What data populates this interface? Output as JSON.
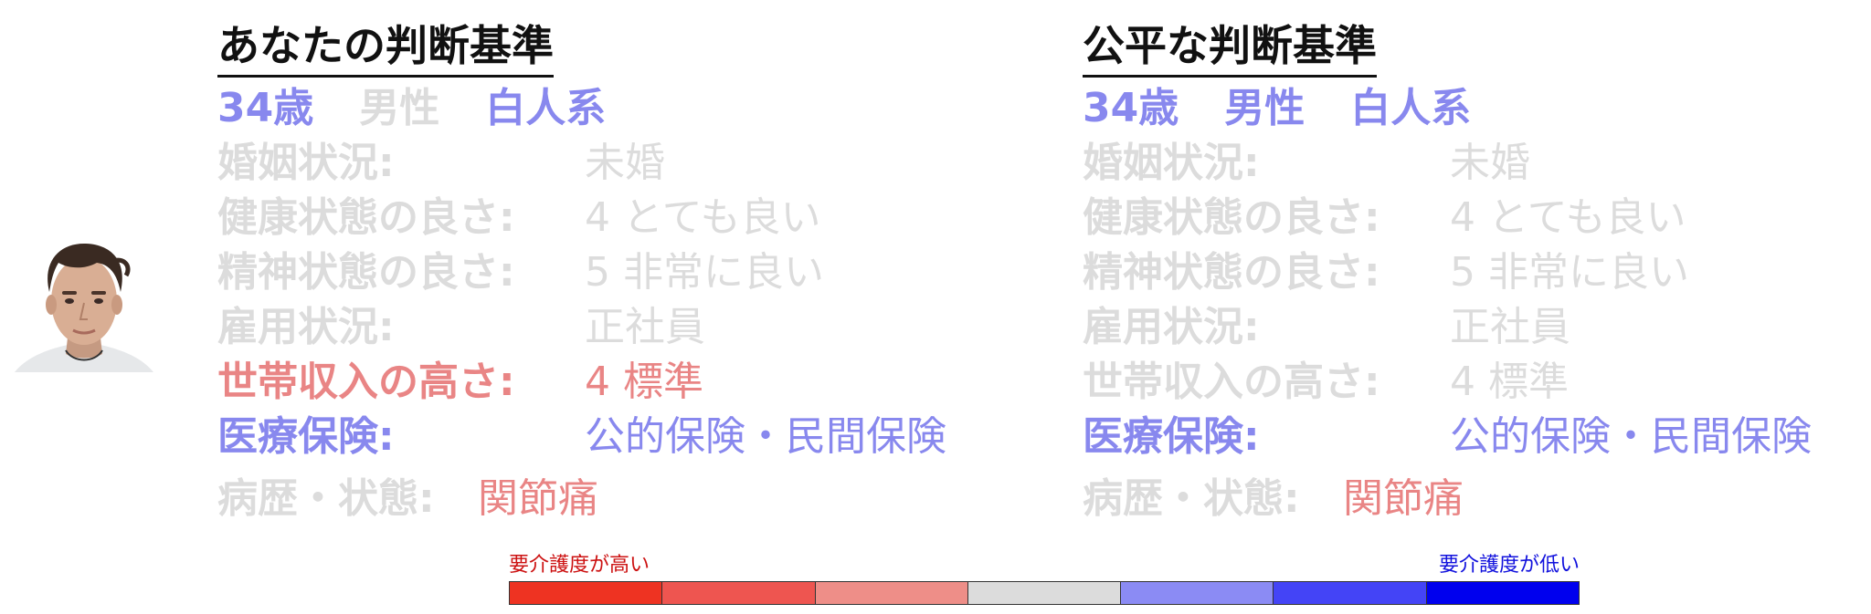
{
  "colors": {
    "grey": "#dcdcdc",
    "accent_blue": "#8888ee",
    "accent_red": "#e98585"
  },
  "avatar": {
    "icon": "person-face-photo"
  },
  "left_panel": {
    "title": "あなたの判断基準",
    "demographics": [
      {
        "text": "34歳",
        "state": "blue"
      },
      {
        "text": "男性",
        "state": "grey"
      },
      {
        "text": "白人系",
        "state": "blue"
      }
    ],
    "rows": [
      {
        "label": "婚姻状況:",
        "value": "未婚",
        "state": "grey"
      },
      {
        "label": "健康状態の良さ:",
        "value": "4 とても良い",
        "state": "grey"
      },
      {
        "label": "精神状態の良さ:",
        "value": "5 非常に良い",
        "state": "grey"
      },
      {
        "label": "雇用状況:",
        "value": "正社員",
        "state": "grey"
      },
      {
        "label": "世帯収入の高さ:",
        "value": "4 標準",
        "state": "red"
      },
      {
        "label": "医療保険:",
        "value": "公的保険・民間保険",
        "state": "blue"
      }
    ],
    "condition": {
      "label": "病歴・状態:",
      "value": "関節痛",
      "label_state": "grey",
      "value_state": "red"
    }
  },
  "right_panel": {
    "title": "公平な判断基準",
    "demographics": [
      {
        "text": "34歳",
        "state": "blue"
      },
      {
        "text": "男性",
        "state": "blue"
      },
      {
        "text": "白人系",
        "state": "blue"
      }
    ],
    "rows": [
      {
        "label": "婚姻状況:",
        "value": "未婚",
        "state": "grey"
      },
      {
        "label": "健康状態の良さ:",
        "value": "4 とても良い",
        "state": "grey"
      },
      {
        "label": "精神状態の良さ:",
        "value": "5 非常に良い",
        "state": "grey"
      },
      {
        "label": "雇用状況:",
        "value": "正社員",
        "state": "grey"
      },
      {
        "label": "世帯収入の高さ:",
        "value": "4 標準",
        "state": "grey"
      },
      {
        "label": "医療保険:",
        "value": "公的保険・民間保険",
        "state": "blue"
      }
    ],
    "condition": {
      "label": "病歴・状態:",
      "value": "関節痛",
      "label_state": "grey",
      "value_state": "red"
    }
  },
  "legend": {
    "high_label": "要介護度が高い",
    "low_label": "要介護度が低い",
    "scale_colors": [
      "#ee3322",
      "#ee5550",
      "#ee8e88",
      "#dcdcdc",
      "#8b8bf4",
      "#4444f6",
      "#0000ee"
    ]
  }
}
